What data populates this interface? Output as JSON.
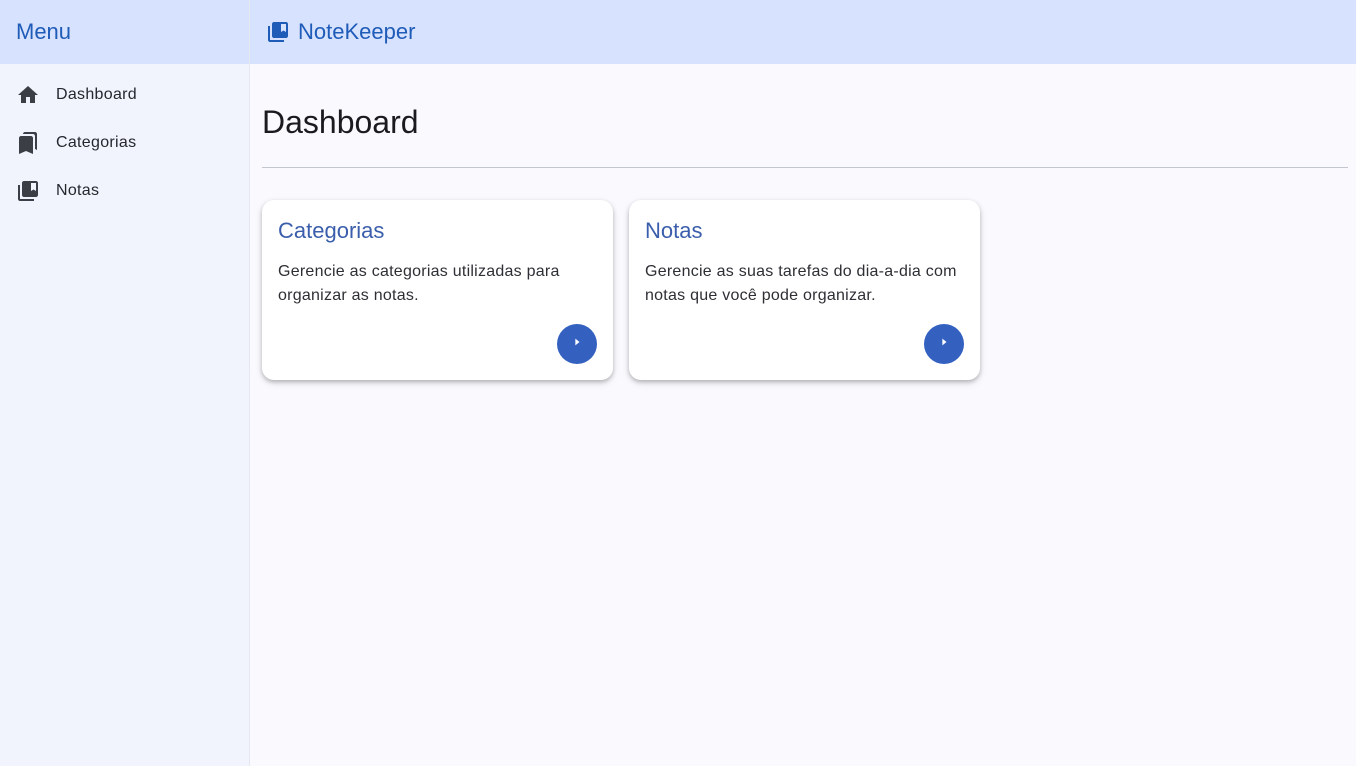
{
  "sidebar": {
    "title": "Menu",
    "items": [
      {
        "label": "Dashboard",
        "icon": "home-icon"
      },
      {
        "label": "Categorias",
        "icon": "bookmarks-icon"
      },
      {
        "label": "Notas",
        "icon": "library-books-icon"
      }
    ]
  },
  "topbar": {
    "app_title": "NoteKeeper",
    "icon": "library-books-icon"
  },
  "main": {
    "page_title": "Dashboard",
    "cards": [
      {
        "title": "Categorias",
        "text": "Gerencie as categorias utilizadas para organizar as notas.",
        "button_icon": "play-arrow-icon"
      },
      {
        "title": "Notas",
        "text": "Gerencie as suas tarefas do dia-a-dia com notas que você pode organizar.",
        "button_icon": "play-arrow-icon"
      }
    ]
  },
  "colors": {
    "header_bg": "#d7e2ff",
    "accent": "#1f5cb8",
    "card_title": "#3a5eab",
    "button_bg": "#3461c0",
    "sidebar_bg": "#f2f4fd",
    "page_bg": "#f9f9fe"
  }
}
